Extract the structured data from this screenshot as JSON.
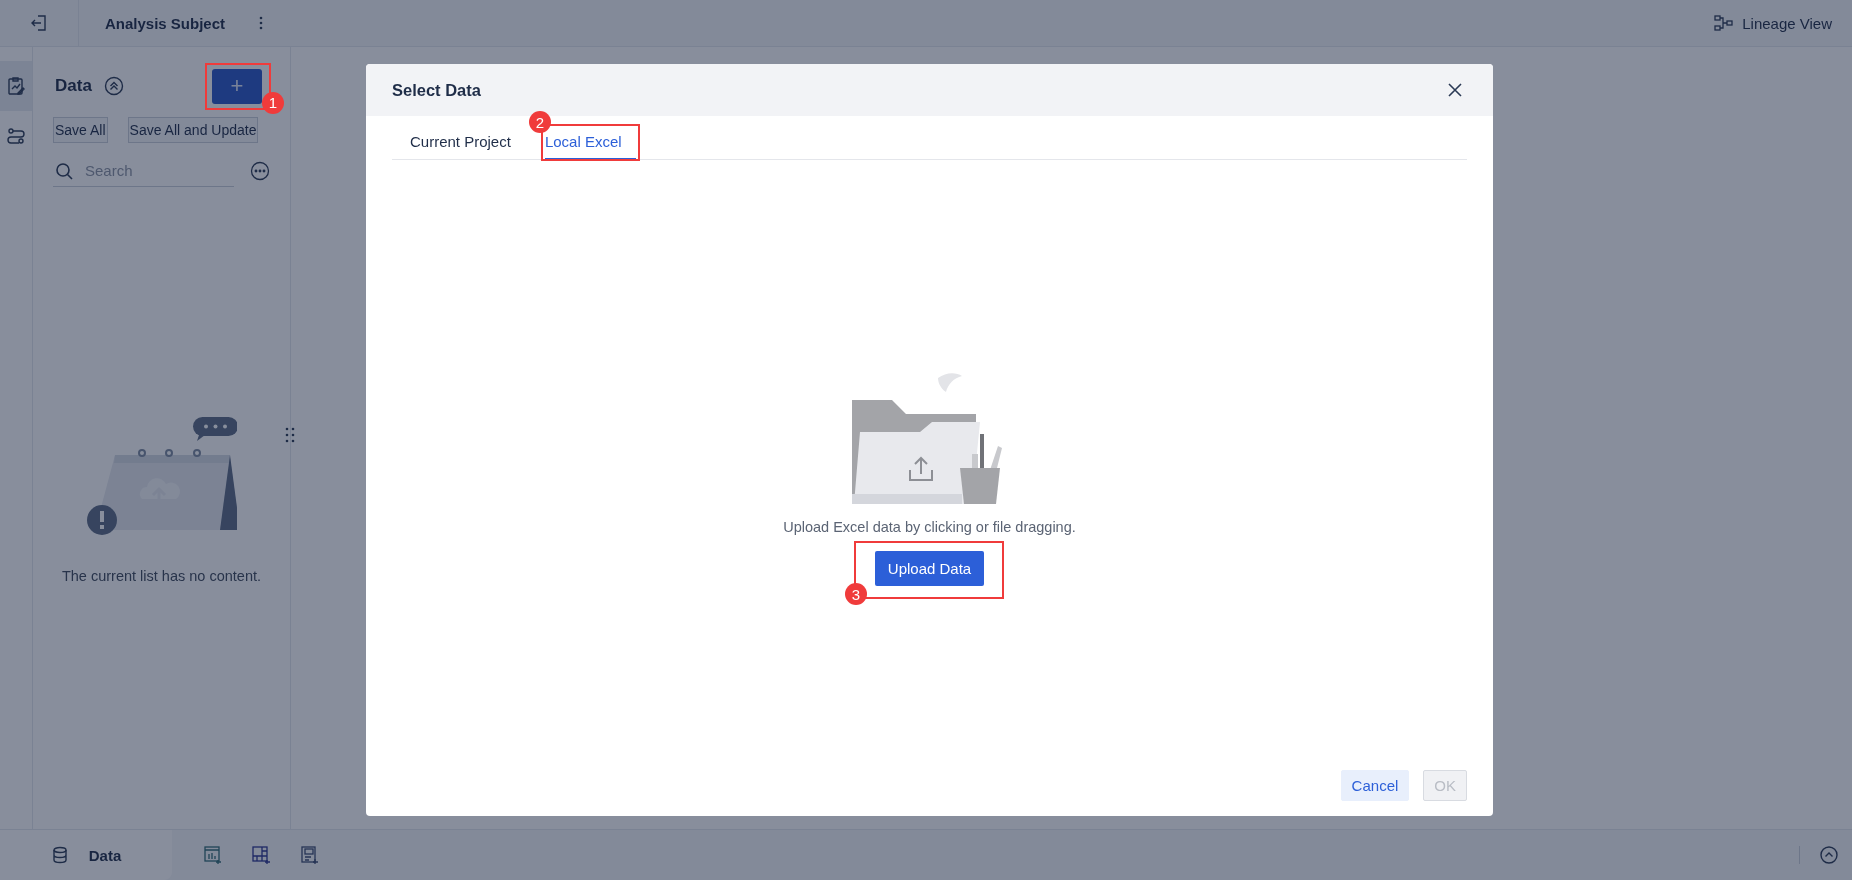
{
  "top_bar": {
    "title": "Analysis Subject",
    "lineage_button": "Lineage View"
  },
  "side_rail": [
    {
      "selected": true
    },
    {
      "selected": false
    }
  ],
  "data_panel": {
    "title": "Data",
    "add_button": {
      "label": "+",
      "annotation": "1"
    },
    "actions": [
      "Save All",
      "Save All and Update"
    ],
    "search": {
      "placeholder": "Search"
    },
    "empty_message": "The current list has no content."
  },
  "dialog": {
    "title": "Select Data",
    "tabs": [
      {
        "label": "Current Project",
        "selected": false
      },
      {
        "label": "Local Excel",
        "selected": true,
        "annotation": "2"
      }
    ],
    "upload_hint": "Upload Excel data by clicking or file dragging.",
    "upload_button": {
      "label": "Upload Data",
      "annotation": "3"
    },
    "buttons": [
      {
        "label": "Cancel",
        "disabled": false
      },
      {
        "label": "OK",
        "disabled": true
      }
    ]
  },
  "bottom_bar": {
    "tabs": [
      {
        "label": "Data",
        "selected": true
      }
    ]
  }
}
